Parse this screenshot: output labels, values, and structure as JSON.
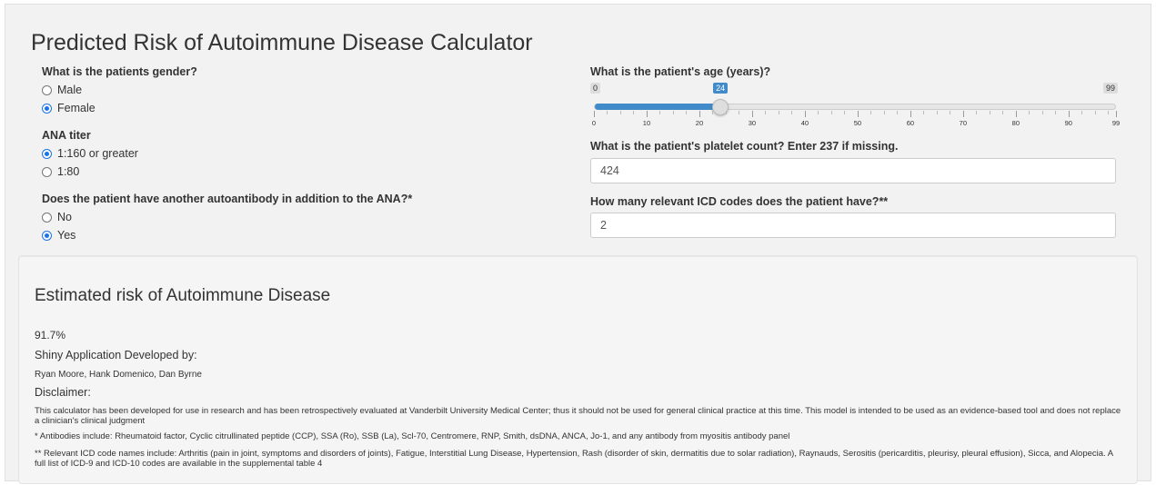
{
  "title": "Predicted Risk of Autoimmune Disease Calculator",
  "gender": {
    "label": "What is the patients gender?",
    "options": [
      {
        "label": "Male",
        "checked": false
      },
      {
        "label": "Female",
        "checked": true
      }
    ]
  },
  "ana": {
    "label": "ANA titer",
    "options": [
      {
        "label": "1:160 or greater",
        "checked": true
      },
      {
        "label": "1:80",
        "checked": false
      }
    ]
  },
  "antibody": {
    "label": "Does the patient have another autoantibody in addition to the ANA?*",
    "options": [
      {
        "label": "No",
        "checked": false
      },
      {
        "label": "Yes",
        "checked": true
      }
    ]
  },
  "age": {
    "label": "What is the patient's age (years)?",
    "min": 0,
    "max": 99,
    "value": 24,
    "min_label": "0",
    "max_label": "99",
    "value_label": "24",
    "tick_labels": [
      "0",
      "10",
      "20",
      "30",
      "40",
      "50",
      "60",
      "70",
      "80",
      "90",
      "99"
    ]
  },
  "platelet": {
    "label": "What is the patient's platelet count? Enter 237 if missing.",
    "value": "424"
  },
  "icd": {
    "label": "How many relevant ICD codes does the patient have?**",
    "value": "2"
  },
  "result": {
    "title": "Estimated risk of Autoimmune Disease",
    "risk": "91.7%",
    "developed_by_label": "Shiny Application Developed by:",
    "developers": "Ryan Moore, Hank Domenico, Dan Byrne",
    "disclaimer_label": "Disclaimer:",
    "disclaimer_text": "This calculator has been developed for use in research and has been retrospectively evaluated at Vanderbilt University Medical Center; thus it should not be used for general clinical practice at this time. This model is intended to be used as an evidence-based tool and does not replace a clinician's clinical judgment",
    "antibodies_note": "* Antibodies include: Rheumatoid factor, Cyclic citrullinated peptide (CCP), SSA (Ro), SSB (La), Scl-70, Centromere, RNP, Smith, dsDNA, ANCA, Jo-1, and any antibody from myositis antibody panel",
    "icd_note": "** Relevant ICD code names include: Arthritis (pain in joint, symptoms and disorders of joints), Fatigue, Interstitial Lung Disease, Hypertension, Rash (disorder of skin, dermatitis due to solar radiation), Raynauds, Serositis (pericarditis, pleurisy, pleural effusion), Sicca, and Alopecia. A full list of ICD-9 and ICD-10 codes are available in the supplemental table 4"
  },
  "colors": {
    "accent": "#428bca",
    "radio_checked": "#1a73e8",
    "panel_bg": "#f2f2f2"
  }
}
